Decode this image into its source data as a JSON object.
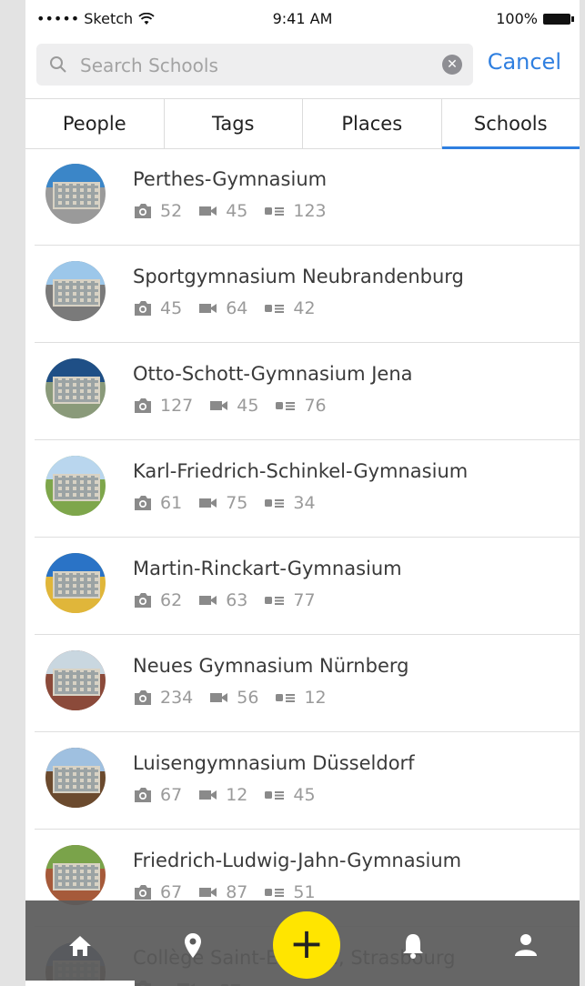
{
  "status": {
    "carrier": "••••• Sketch",
    "time": "9:41 AM",
    "battery": "100%"
  },
  "search": {
    "placeholder": "Search Schools",
    "value": "",
    "cancel_label": "Cancel"
  },
  "tabs": [
    {
      "label": "People"
    },
    {
      "label": "Tags"
    },
    {
      "label": "Places"
    },
    {
      "label": "Schools",
      "active": true
    }
  ],
  "schools": [
    {
      "name": "Perthes-Gymnasium",
      "photos": "52",
      "videos": "45",
      "posts": "123",
      "sky": "#3b86c8",
      "ground": "#9a9a9a"
    },
    {
      "name": "Sportgymnasium Neubrandenburg",
      "photos": "45",
      "videos": "64",
      "posts": "42",
      "sky": "#9cc7ea",
      "ground": "#7a7a7a"
    },
    {
      "name": "Otto-Schott-Gymnasium Jena",
      "photos": "127",
      "videos": "45",
      "posts": "76",
      "sky": "#1f4f86",
      "ground": "#8a9a7a"
    },
    {
      "name": "Karl-Friedrich-Schinkel-Gymnasium",
      "photos": "61",
      "videos": "75",
      "posts": "34",
      "sky": "#b9d6ee",
      "ground": "#7ea64b"
    },
    {
      "name": "Martin-Rinckart-Gymnasium",
      "photos": "62",
      "videos": "63",
      "posts": "77",
      "sky": "#2a73c6",
      "ground": "#e0b63a"
    },
    {
      "name": "Neues Gymnasium Nürnberg",
      "photos": "234",
      "videos": "56",
      "posts": "12",
      "sky": "#c9d7e0",
      "ground": "#8b4a3a"
    },
    {
      "name": "Luisengymnasium Düsseldorf",
      "photos": "67",
      "videos": "12",
      "posts": "45",
      "sky": "#9fc0e0",
      "ground": "#6b4a2e"
    },
    {
      "name": "Friedrich-Ludwig-Jahn-Gymnasium",
      "photos": "67",
      "videos": "87",
      "posts": "51",
      "sky": "#7aa34a",
      "ground": "#a65a3a"
    },
    {
      "name": "Collège Saint-Etienne, Strasbourg",
      "photos": "",
      "videos": "",
      "posts": "",
      "sky": "#3a5c8a",
      "ground": "#5a3a2a"
    }
  ],
  "tabbar": {
    "icons": [
      "home-icon",
      "location-pin-icon",
      "add-icon",
      "bell-icon",
      "profile-icon"
    ],
    "fab_label": "+"
  }
}
